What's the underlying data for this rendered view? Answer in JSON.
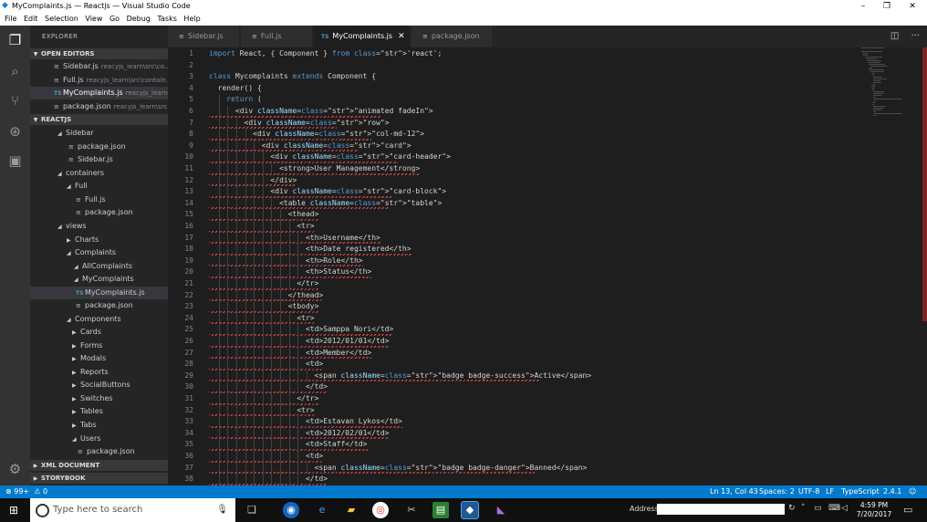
{
  "window": {
    "title": "MyComplaints.js — Reactjs — Visual Studio Code",
    "controls": [
      "–",
      "❐",
      "✕"
    ]
  },
  "menu": [
    "File",
    "Edit",
    "Selection",
    "View",
    "Go",
    "Debug",
    "Tasks",
    "Help"
  ],
  "sidebar": {
    "title": "EXPLORER",
    "open_editors_label": "OPEN EDITORS",
    "open_editors": [
      {
        "name": "Sidebar.js",
        "path": "reacyjs_learn\\src\\co..."
      },
      {
        "name": "Full.js",
        "path": "reacyjs_learn\\src\\contain..."
      },
      {
        "name": "MyComplaints.js",
        "path": "reacyjs_learn..."
      },
      {
        "name": "package.json",
        "path": "reacyjs_learn\\src..."
      }
    ],
    "project_label": "REACTJS",
    "tree": [
      "Sidebar",
      "package.json",
      "Sidebar.js",
      "containers",
      "Full",
      "Full.js",
      "package.json",
      "views",
      "Charts",
      "Complaints",
      "AllComplaints",
      "MyComplaints",
      "MyComplaints.js",
      "package.json",
      "Components",
      "Cards",
      "Forms",
      "Modals",
      "Reports",
      "SocialButtons",
      "Switches",
      "Tables",
      "Tabs",
      "Users",
      "package.json"
    ],
    "bottom_sections": [
      "XML DOCUMENT",
      "STORYBOOK"
    ]
  },
  "tabs": [
    "Sidebar.js",
    "Full.js",
    "MyComplaints.js",
    "package.json"
  ],
  "editor": {
    "lines": [
      "import React, { Component } from 'react';",
      "",
      "class Mycomplaints extends Component {",
      "  render() {",
      "    return (",
      "      <div className=\"animated fadeIn\">",
      "        <div className=\"row\">",
      "          <div className=\"col-md-12\">",
      "            <div className=\"card\">",
      "              <div className=\"card-header\">",
      "                <strong>User Management</strong>",
      "              </div>",
      "              <div className=\"card-block\">",
      "                <table className=\"table\">",
      "                  <thead>",
      "                    <tr>",
      "                      <th>Username</th>",
      "                      <th>Date registered</th>",
      "                      <th>Role</th>",
      "                      <th>Status</th>",
      "                    </tr>",
      "                  </thead>",
      "                  <tbody>",
      "                    <tr>",
      "                      <td>Samppa Nori</td>",
      "                      <td>2012/01/01</td>",
      "                      <td>Member</td>",
      "                      <td>",
      "                        <span className=\"badge badge-success\">Active</span>",
      "                      </td>",
      "                    </tr>",
      "                    <tr>",
      "                      <td>Estavan Lykos</td>",
      "                      <td>2012/02/01</td>",
      "                      <td>Staff</td>",
      "                      <td>",
      "                        <span className=\"badge badge-danger\">Banned</span>",
      "                      </td>"
    ]
  },
  "status": {
    "errors": "⊗ 99+",
    "warnings": "⚠ 0",
    "position": "Ln 13, Col 43",
    "spaces": "Spaces: 2",
    "encoding": "UTF-8",
    "eol": "LF",
    "language": "TypeScript",
    "version": "2.4.1",
    "feedback_icon": "☺"
  },
  "taskbar": {
    "search_placeholder": "Type here to search",
    "address_label": "Address",
    "time": "4:59 PM",
    "date": "7/20/2017"
  }
}
